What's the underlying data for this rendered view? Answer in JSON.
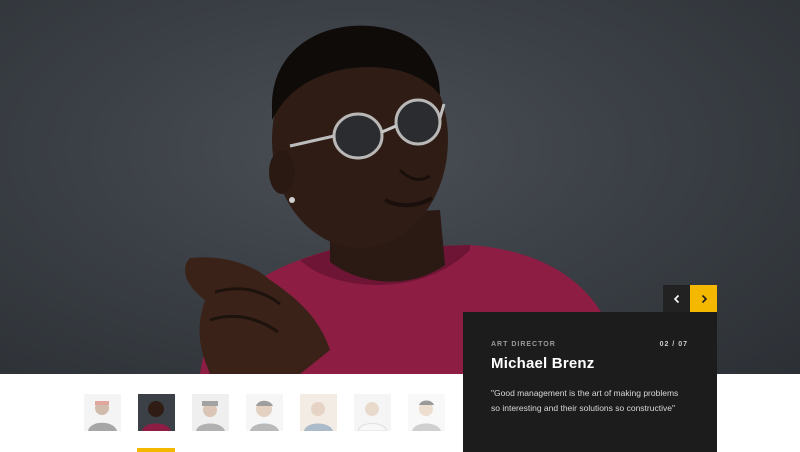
{
  "slide": {
    "role": "ART DIRECTOR",
    "name": "Michael Brenz",
    "quote": "\"Good management is the art of making problems so interesting and their solutions so constructive\"",
    "counter": "02 / 07",
    "current_index": 2,
    "total": 7
  },
  "navigation": {
    "prev_icon": "chevron-left-icon",
    "next_icon": "chevron-right-icon"
  },
  "colors": {
    "accent": "#f5b800",
    "card_bg": "#1c1c1c",
    "hero_bg": "#3b4046"
  },
  "thumbnails": [
    {
      "name": "thumb-person-1",
      "active": false
    },
    {
      "name": "thumb-person-2",
      "active": true
    },
    {
      "name": "thumb-person-3",
      "active": false
    },
    {
      "name": "thumb-person-4",
      "active": false
    },
    {
      "name": "thumb-person-5",
      "active": false
    },
    {
      "name": "thumb-person-6",
      "active": false
    },
    {
      "name": "thumb-person-7",
      "active": false
    }
  ]
}
